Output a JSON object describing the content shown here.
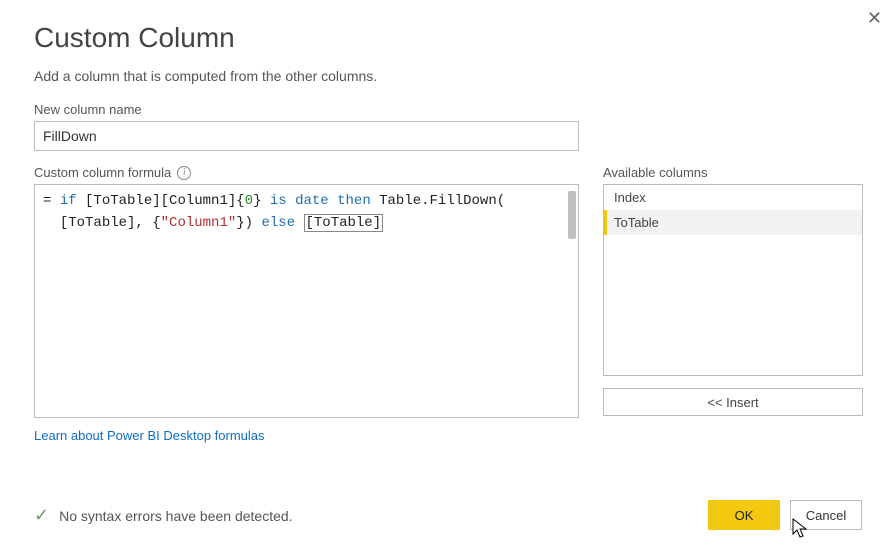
{
  "header": {
    "title": "Custom Column",
    "subtitle": "Add a column that is computed from the other columns."
  },
  "name_field": {
    "label": "New column name",
    "value": "FillDown"
  },
  "formula_field": {
    "label": "Custom column formula",
    "tokens": {
      "eq": "= ",
      "if": "if",
      "expr1_a": " [ToTable][Column1]{",
      "zero": "0",
      "expr1_b": "} ",
      "is": "is",
      "sp1": " ",
      "date": "date",
      "sp2": " ",
      "then": "then",
      "expr2": " Table.FillDown(",
      "line2_a": "[ToTable], {",
      "str": "\"Column1\"",
      "line2_b": "}) ",
      "else": "else",
      "sp3": " ",
      "totable": "[ToTable]"
    }
  },
  "available": {
    "label": "Available columns",
    "items": [
      "Index",
      "ToTable"
    ],
    "selected_index": 1,
    "insert_label": "<< Insert"
  },
  "learn_link": "Learn about Power BI Desktop formulas",
  "status": {
    "message": "No syntax errors have been detected."
  },
  "buttons": {
    "ok": "OK",
    "cancel": "Cancel"
  }
}
